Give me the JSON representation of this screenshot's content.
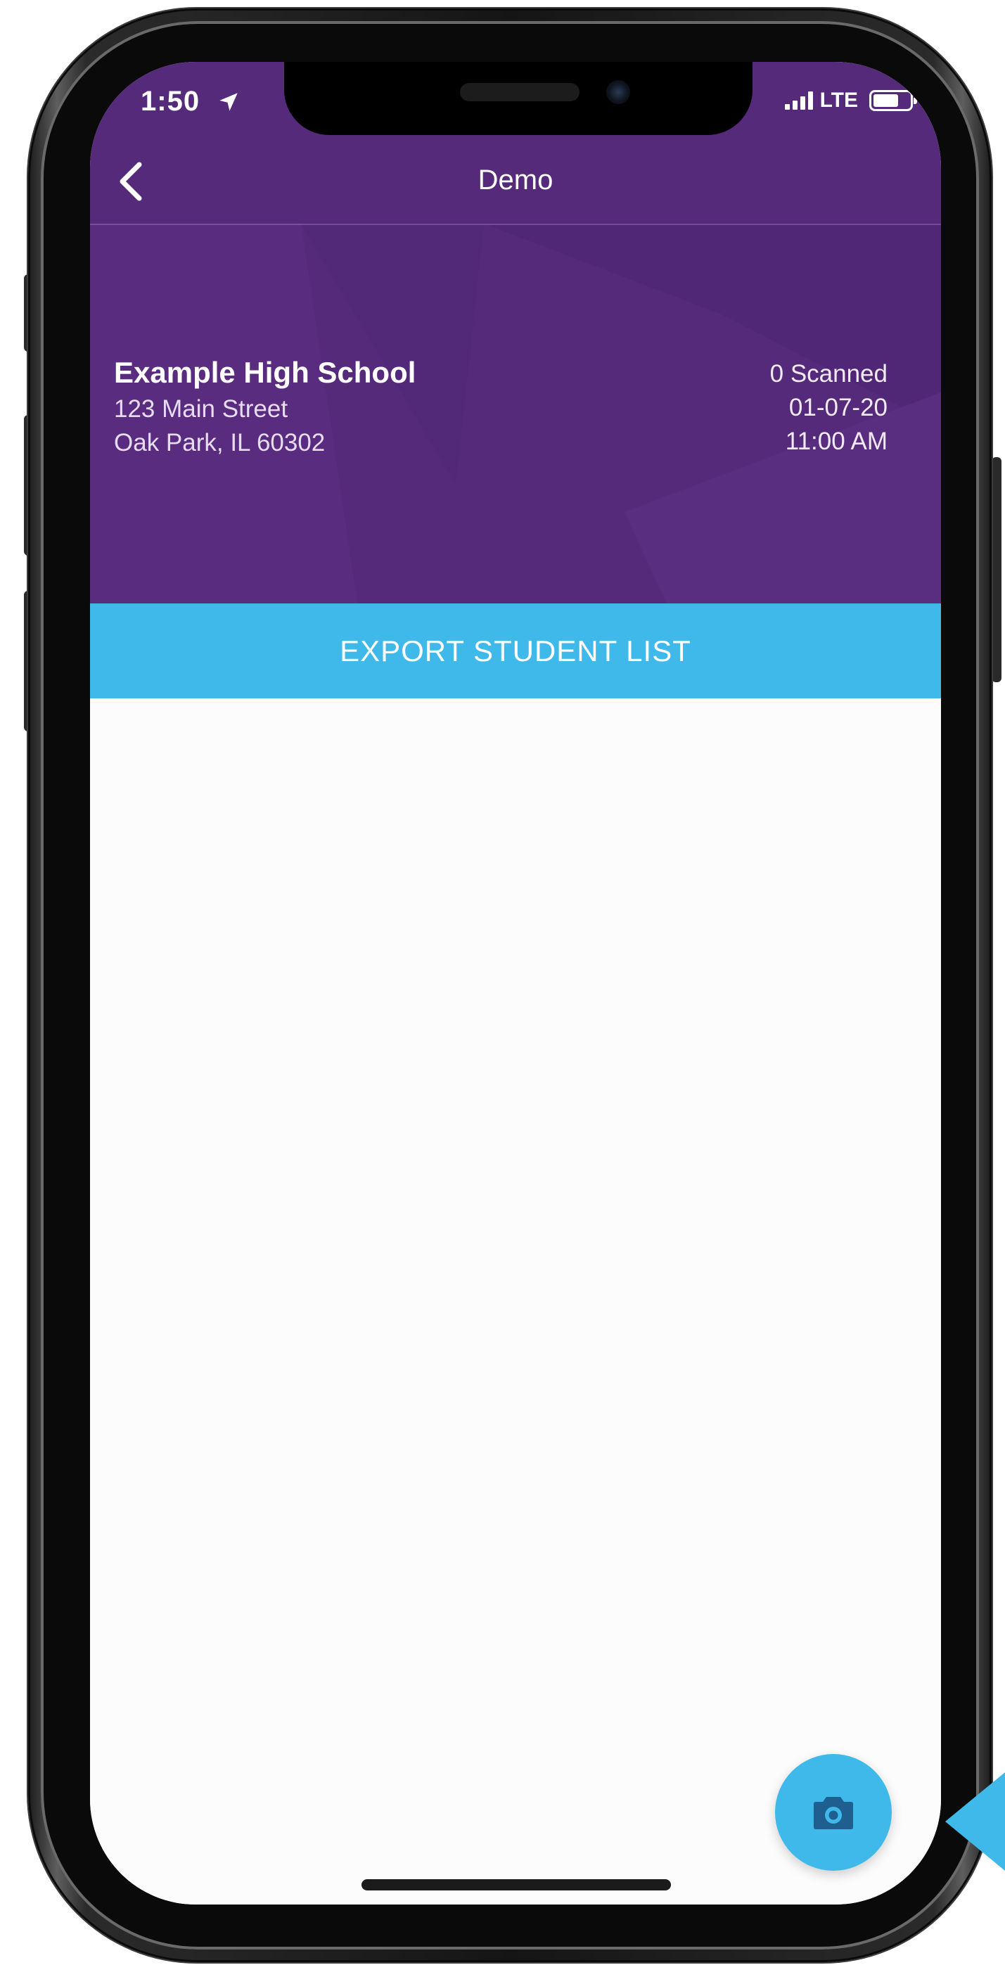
{
  "status_bar": {
    "time": "1:50",
    "network": "LTE",
    "battery_level": 0.7
  },
  "nav": {
    "title": "Demo",
    "back_icon": "chevron-left-icon"
  },
  "event": {
    "school_name": "Example High School",
    "address_line1": "123 Main Street",
    "address_line2": "Oak Park, IL 60302",
    "scanned_count": "0 Scanned",
    "date": "01-07-20",
    "time": "11:00 AM"
  },
  "export_button": {
    "label": "EXPORT STUDENT LIST"
  },
  "scan_button": {
    "icon": "camera-icon"
  },
  "colors": {
    "header_purple": "#552a7b",
    "accent_blue": "#3eb9ea",
    "list_background": "#fcfcfc"
  }
}
